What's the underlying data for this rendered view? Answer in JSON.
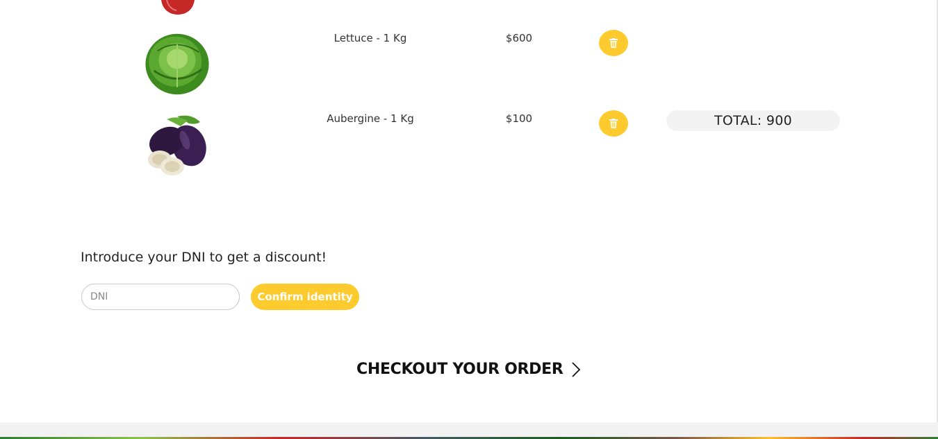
{
  "cart": {
    "items": [
      {
        "name": "Lettuce - 1 Kg",
        "price": "$600",
        "image_icon": "lettuce-icon",
        "delete_icon": "trash-icon"
      },
      {
        "name": "Aubergine - 1 Kg",
        "price": "$100",
        "image_icon": "aubergine-icon",
        "delete_icon": "trash-icon"
      }
    ],
    "total": "TOTAL: 900"
  },
  "discount": {
    "title": "Introduce your DNI to get a discount!",
    "input_placeholder": "DNI",
    "input_value": "",
    "confirm_label": "Confirm identity"
  },
  "checkout": {
    "label": "CHECKOUT YOUR ORDER",
    "icon": "chevron-right-icon"
  },
  "colors": {
    "accent": "#fdcb2e",
    "total_bg": "#f3f3f3",
    "footer_bg": "#f2f2f2"
  }
}
